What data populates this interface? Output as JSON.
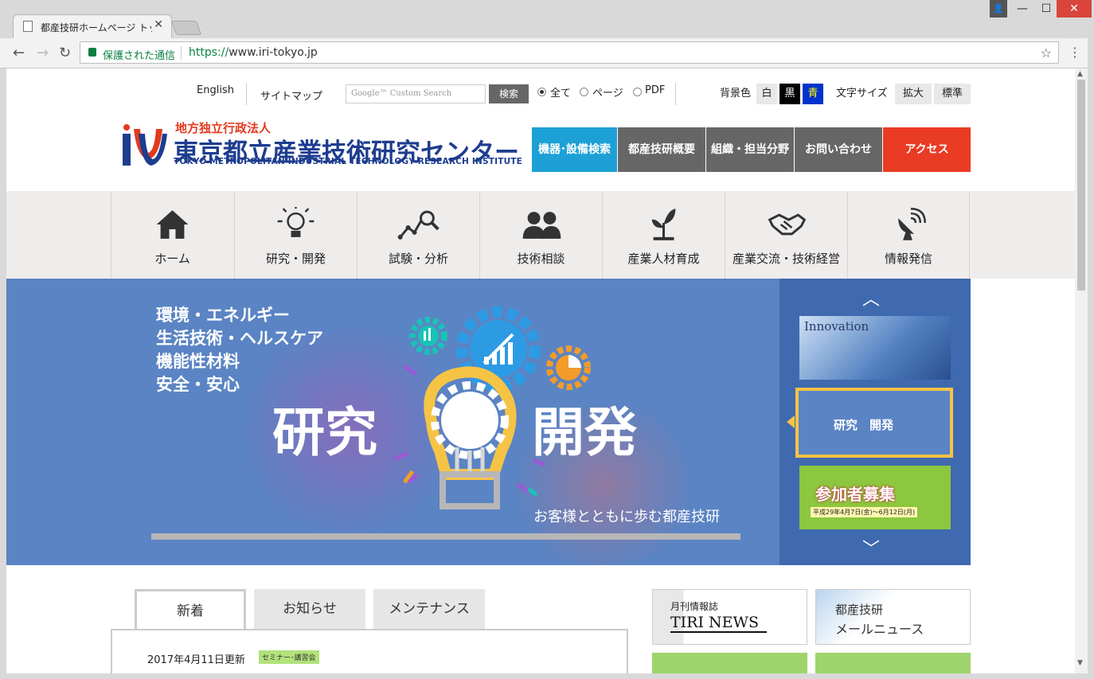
{
  "browser": {
    "tab_title": "都産技研ホームページ トップ",
    "tab_close": "✕",
    "window_user": "👤",
    "window_min": "—",
    "window_max": "☐",
    "window_close": "✕",
    "back": "←",
    "forward": "→",
    "reload": "↻",
    "secure_label": "保護された通信",
    "url_scheme": "https://",
    "url_host": "www.iri-tokyo.jp",
    "star": "☆",
    "menu": "⋮"
  },
  "utility": {
    "english": "English",
    "sitemap": "サイトマップ",
    "search_placeholder": "Google™ Custom Search",
    "search_button": "検索",
    "scope_all": "全て",
    "scope_page": "ページ",
    "scope_pdf": "PDF",
    "bg_label": "背景色",
    "bg_white": "白",
    "bg_black": "黒",
    "bg_blue": "青",
    "font_label": "文字サイズ",
    "font_large": "拡大",
    "font_normal": "標準"
  },
  "logo": {
    "small": "地方独立行政法人",
    "main": "東京都立産業技術研究センター",
    "english": "TOKYO METROPOLITAN INDUSTRIAL TECHNOLOGY RESEARCH INSTITUTE"
  },
  "topnav": [
    {
      "label": "機器･設備検索",
      "color": "#1ca0d6"
    },
    {
      "label": "都産技研概要",
      "color": "#666666"
    },
    {
      "label": "組織・担当分野",
      "color": "#666666"
    },
    {
      "label": "お問い合わせ",
      "color": "#666666"
    },
    {
      "label": "アクセス",
      "color": "#ea3b24"
    }
  ],
  "mainnav": [
    {
      "label": "ホーム",
      "icon": "home-icon"
    },
    {
      "label": "研究・開発",
      "icon": "lightbulb-icon"
    },
    {
      "label": "試験・分析",
      "icon": "analysis-icon"
    },
    {
      "label": "技術相談",
      "icon": "people-icon"
    },
    {
      "label": "産業人材育成",
      "icon": "sprout-icon"
    },
    {
      "label": "産業交流・技術経営",
      "icon": "handshake-icon"
    },
    {
      "label": "情報発信",
      "icon": "satellite-icon"
    }
  ],
  "hero": {
    "categories": [
      "環境・エネルギー",
      "生活技術・ヘルスケア",
      "機能性材料",
      "安全・安心"
    ],
    "big_left": "研究",
    "big_right": "開発",
    "tagline": "お客様とともに歩む都産技研"
  },
  "slider": {
    "up": "︿",
    "down": "﹀",
    "thumb1_title": "Innovation",
    "thumb2_title": "研究　開発",
    "thumb3_title": "参加者募集",
    "thumb3_date": "平成29年4月7日(金)～6月12日(月)"
  },
  "news": {
    "tabs": [
      "新着",
      "お知らせ",
      "メンテナンス"
    ],
    "date": "2017年4月11日更新",
    "badge": "セミナー･講習会"
  },
  "banners": {
    "tiri_small": "月刊情報誌",
    "tiri_title": "TIRI NEWS",
    "mail_line1": "都産技研",
    "mail_line2": "メールニュース"
  }
}
